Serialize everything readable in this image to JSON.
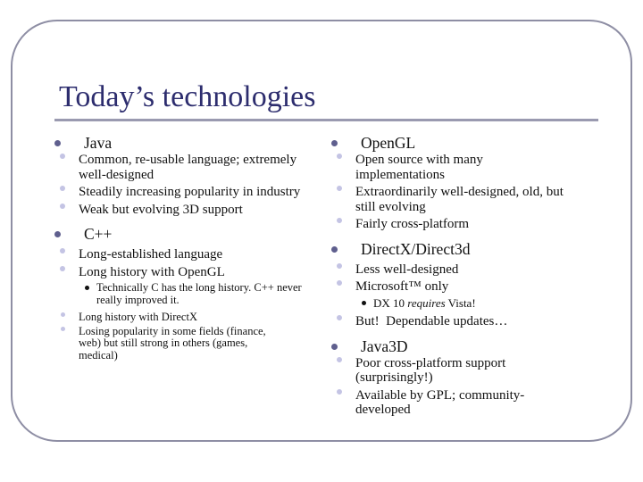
{
  "slide": {
    "title": "Today’s technologies",
    "left_column": [
      {
        "label": "Java",
        "items": [
          {
            "text": "Common, re-usable language; extremely well-designed",
            "size": "normal"
          },
          {
            "text": "Steadily increasing popularity in industry",
            "size": "normal"
          },
          {
            "text": "Weak but evolving 3D support",
            "size": "normal"
          }
        ]
      },
      {
        "label": "C++",
        "items": [
          {
            "text": "Long-established language",
            "size": "normal"
          },
          {
            "text": "Long history with OpenGL",
            "size": "normal",
            "subitems": [
              "Technically C has the long history. C++ never really improved it."
            ]
          },
          {
            "text": "Long history with DirectX",
            "size": "small"
          },
          {
            "text": "Losing popularity in some fields (finance, web) but still strong in others (games, medical)",
            "size": "small"
          }
        ]
      }
    ],
    "right_column": [
      {
        "label": "OpenGL",
        "items": [
          {
            "text": "Open source with many implementations",
            "size": "normal"
          },
          {
            "text": "Extraordinarily well-designed, old, but still evolving",
            "size": "normal"
          },
          {
            "text": "Fairly cross-platform",
            "size": "normal"
          }
        ]
      },
      {
        "label": "DirectX/Direct3d",
        "items": [
          {
            "text": "Less well-designed",
            "size": "normal"
          },
          {
            "text": "Microsoft™ only",
            "size": "normal",
            "subitems_rich": [
              {
                "pre": "DX 10 ",
                "em": "requires",
                "post": " Vista!"
              }
            ]
          },
          {
            "text": "But!  Dependable updates…",
            "size": "normal"
          }
        ]
      },
      {
        "label": "Java3D",
        "items": [
          {
            "text": "Poor cross-platform support (surprisingly!)",
            "size": "normal"
          },
          {
            "text": "Available by GPL; community-developed",
            "size": "normal"
          }
        ]
      }
    ]
  },
  "colors": {
    "title": "#2d2d6e",
    "rule": "#9a9ab0",
    "frame": "#8e8ea4",
    "bullet_level1": "#5f5f8e",
    "bullet_level2": "#c4c4e4",
    "bullet_level3": "#111111"
  }
}
